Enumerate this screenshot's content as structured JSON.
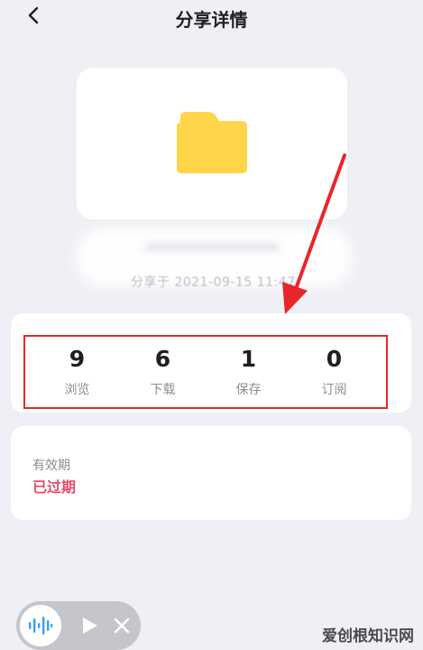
{
  "header": {
    "title": "分享详情"
  },
  "share": {
    "time_text": "分享于 2021-09-15 11:47"
  },
  "stats": [
    {
      "value": "9",
      "label": "浏览"
    },
    {
      "value": "6",
      "label": "下载"
    },
    {
      "value": "1",
      "label": "保存"
    },
    {
      "value": "0",
      "label": "订阅"
    }
  ],
  "validity": {
    "label": "有效期",
    "value": "已过期"
  },
  "watermark": {
    "text": "爱创根知识网"
  },
  "colors": {
    "background": "#eef0f5",
    "folder": "#ffd54a",
    "highlight_border": "#e8262a",
    "expired": "#e74a6a"
  }
}
